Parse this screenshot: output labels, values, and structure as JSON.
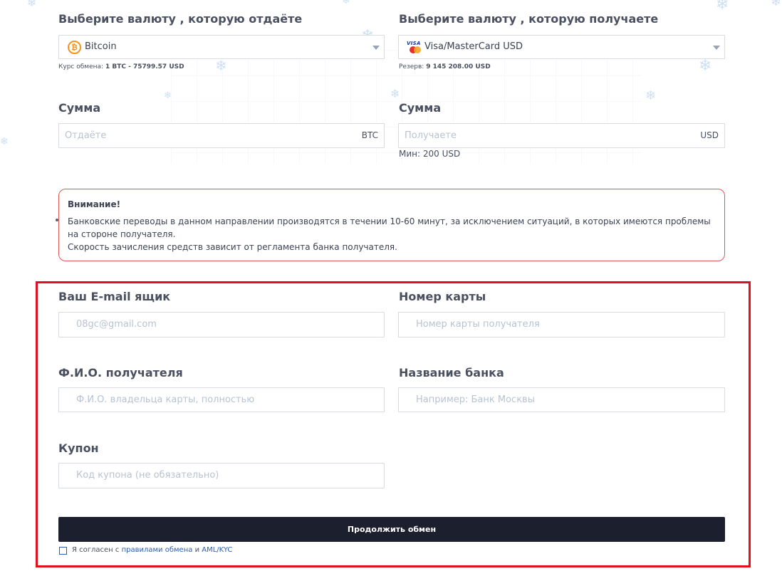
{
  "colors": {
    "title_text": "#4a5060",
    "placeholder": "#b8c3d1",
    "alert_border": "#e45757",
    "button_bg": "#1c1f2e",
    "link": "#2b5dad",
    "highlight_frame": "#e0101e",
    "snowflake": "#cfe0f3"
  },
  "give": {
    "title": "Выберите валюту , которую отдаёте",
    "selected": "Bitcoin",
    "icon": "bitcoin-icon",
    "rate_label": "Курс обмена:",
    "rate_value": "1 BTC - 75799.57 USD"
  },
  "receive": {
    "title": "Выберите валюту , которую получаете",
    "selected": "Visa/MasterCard USD",
    "icon": "visa-mastercard-icon",
    "reserve_label": "Резерв:",
    "reserve_value": "9 145 208.00 USD"
  },
  "amount_give": {
    "title": "Сумма",
    "placeholder": "Отдаёте",
    "currency": "BTC"
  },
  "amount_receive": {
    "title": "Сумма",
    "placeholder": "Получаете",
    "currency": "USD",
    "min": "Мин: 200 USD"
  },
  "alert": {
    "title": "Внимание!",
    "line1": "Банковские переводы в данном направлении производятся в течении 10-60 минут, за исключением ситуаций, в которых имеются проблемы на стороне получателя.",
    "line2": "Скорость зачисления средств зависит от регламента банка получателя."
  },
  "form": {
    "email": {
      "title": "Ваш E-mail ящик",
      "placeholder": "08gc@gmail.com"
    },
    "card": {
      "title": "Номер карты",
      "placeholder": "Номер карты получателя"
    },
    "fio": {
      "title": "Ф.И.О. получателя",
      "placeholder": "Ф.И.О. владельца карты, полностью"
    },
    "bank": {
      "title": "Название банка",
      "placeholder": "Например: Банк Москвы"
    },
    "coupon": {
      "title": "Купон",
      "placeholder": "Код купона (не обязательно)"
    }
  },
  "submit_label": "Продолжить обмен",
  "agreement": {
    "prefix": "Я согласен с",
    "rules_link": "правилами обмена",
    "conj": "и",
    "aml_link": "AML/KYC"
  }
}
